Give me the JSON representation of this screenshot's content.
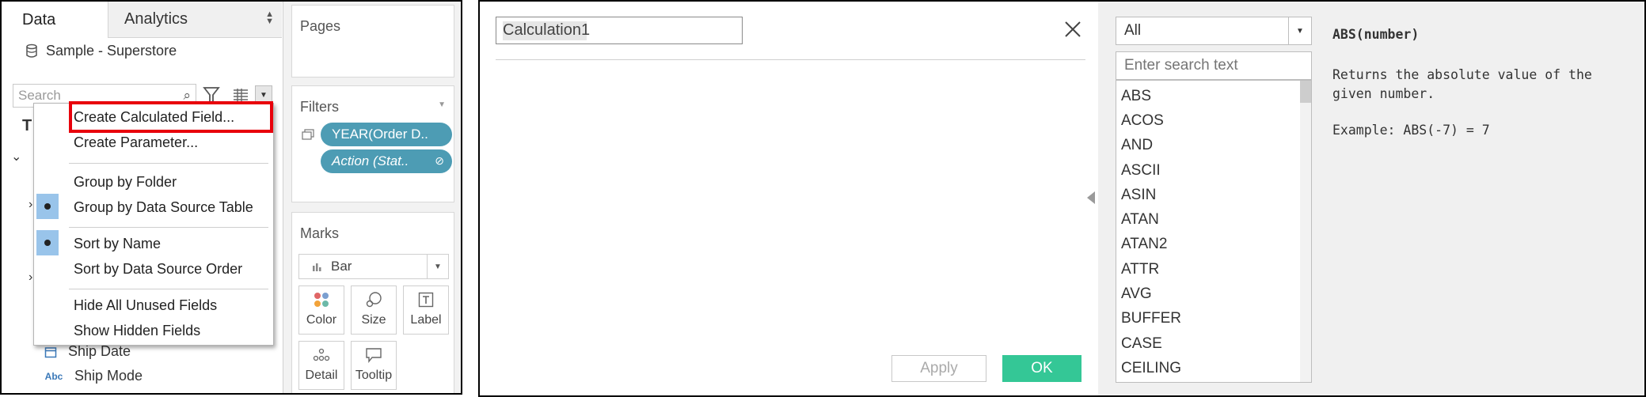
{
  "data_pane": {
    "tabs": [
      "Data",
      "Analytics"
    ],
    "datasource": "Sample - Superstore",
    "search_placeholder": "Search",
    "visible_fields": [
      {
        "type": "date",
        "label": "Ship Date"
      },
      {
        "type": "Abc",
        "label": "Ship Mode"
      }
    ],
    "stub_letters": [
      "T",
      "⌄",
      "›",
      "›"
    ]
  },
  "context_menu": {
    "items": [
      {
        "label": "Create Calculated Field...",
        "highlighted": true
      },
      {
        "label": "Create Parameter..."
      },
      {
        "label": "Group by Folder"
      },
      {
        "label": "Group by Data Source Table",
        "checked": true
      },
      {
        "label": "Sort by Name",
        "checked": true
      },
      {
        "label": "Sort by Data Source Order"
      },
      {
        "label": "Hide All Unused Fields"
      },
      {
        "label": "Show Hidden Fields"
      }
    ],
    "highlight_color": "#e8000b"
  },
  "shelves": {
    "pages_title": "Pages",
    "filters_title": "Filters",
    "filter_pills": [
      "YEAR(Order D..",
      "Action (Stat.."
    ],
    "marks_title": "Marks",
    "mark_type": "Bar",
    "mark_buttons": [
      "Color",
      "Size",
      "Label",
      "Detail",
      "Tooltip"
    ]
  },
  "calc_editor": {
    "name": "Calculation1",
    "apply_label": "Apply",
    "ok_label": "OK",
    "ok_color": "#34c796"
  },
  "functions": {
    "category": "All",
    "search_placeholder": "Enter search text",
    "list": [
      "ABS",
      "ACOS",
      "AND",
      "ASCII",
      "ASIN",
      "ATAN",
      "ATAN2",
      "ATTR",
      "AVG",
      "BUFFER",
      "CASE",
      "CEILING"
    ],
    "doc": {
      "signature": "ABS(number)",
      "description": "Returns the absolute value of the given number.",
      "example": "Example: ABS(-7) = 7"
    }
  },
  "pill_color": "#4d9cb4"
}
